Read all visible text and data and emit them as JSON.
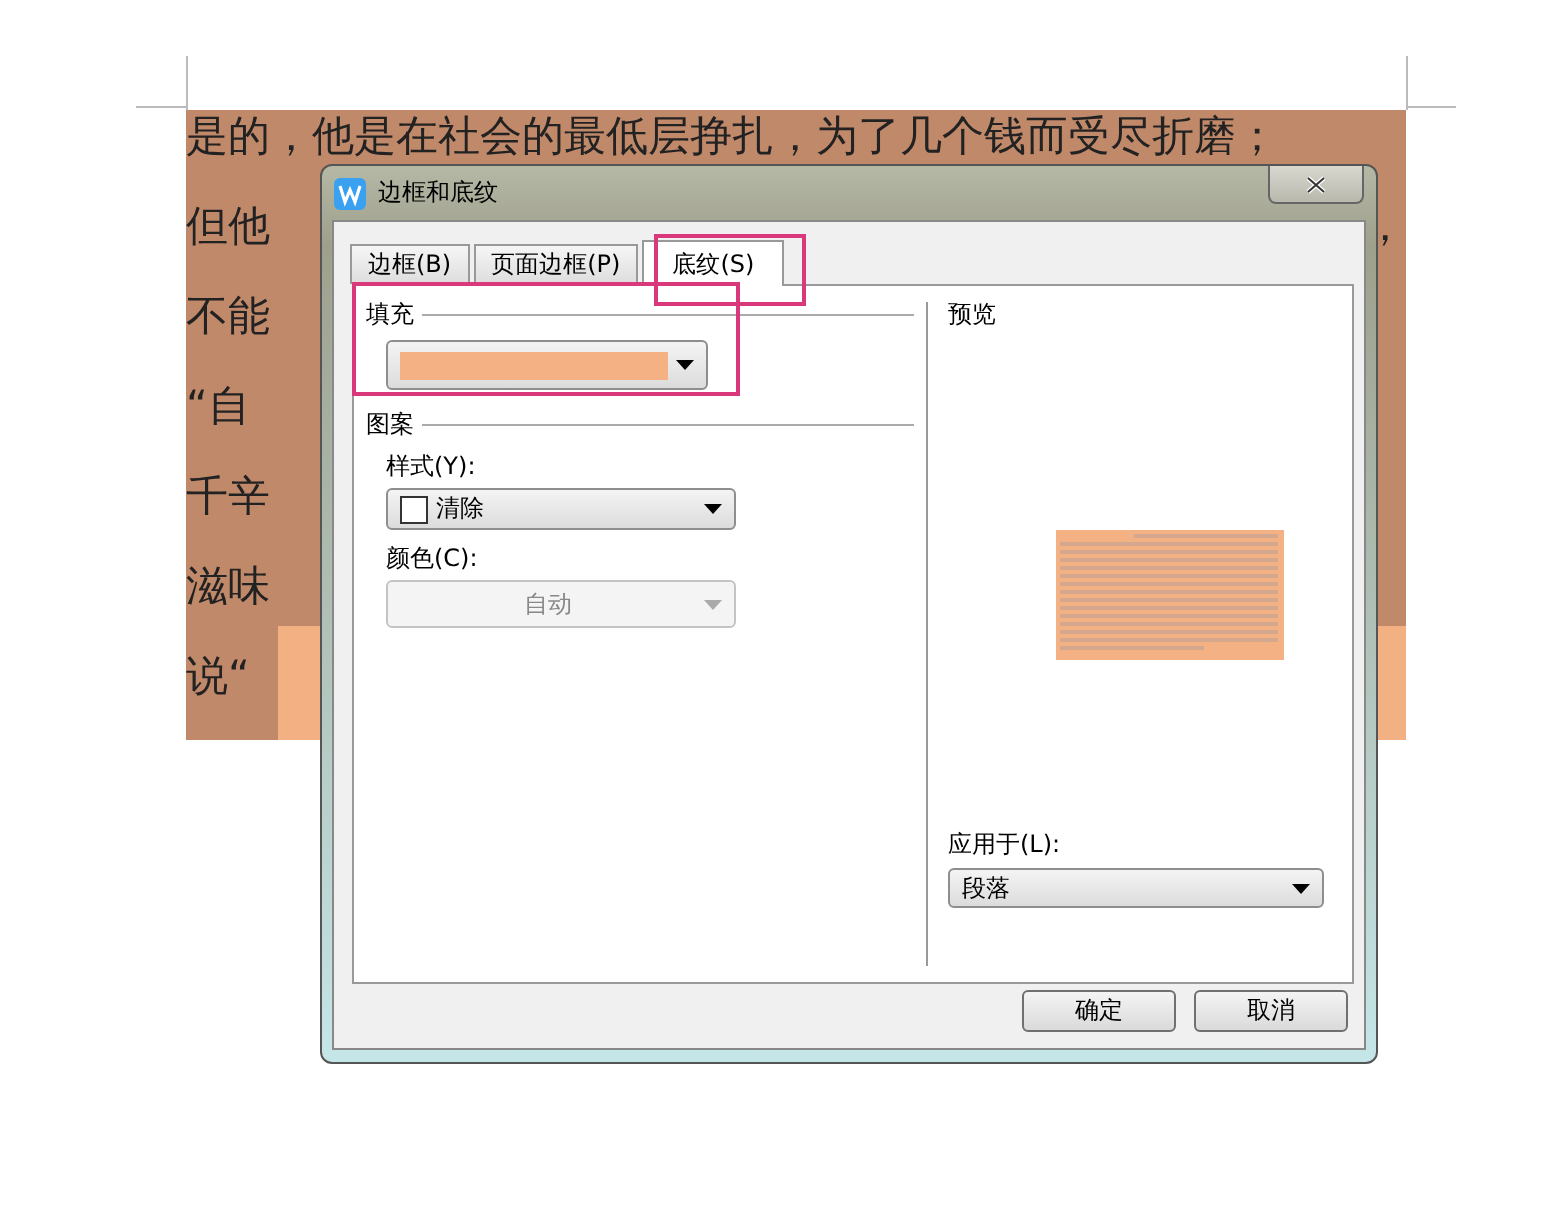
{
  "document": {
    "lines": [
      {
        "left": "是的，他是在社会的最低层挣扎，为了几个钱而受尽折磨；",
        "highlighted": false
      },
      {
        "left": "但他",
        "right": "，",
        "highlighted": false
      },
      {
        "left": "不能",
        "highlighted": false
      },
      {
        "left": "“自",
        "highlighted": false
      },
      {
        "left": "千辛",
        "highlighted": false
      },
      {
        "left": "滋味",
        "highlighted": false
      },
      {
        "left": "说“",
        "highlighted": true
      }
    ]
  },
  "dialog": {
    "title": "边框和底纹",
    "tabs": [
      {
        "label": "边框(B)",
        "selected": false
      },
      {
        "label": "页面边框(P)",
        "selected": false
      },
      {
        "label": "底纹(S)",
        "selected": true
      }
    ],
    "fill": {
      "label": "填充",
      "color": "#f4b183"
    },
    "pattern": {
      "label": "图案",
      "style_label": "样式(Y):",
      "style_value": "清除",
      "color_label": "颜色(C):",
      "color_value": "自动",
      "color_disabled": true
    },
    "preview": {
      "label": "预览"
    },
    "apply_to": {
      "label": "应用于(L):",
      "value": "段落"
    },
    "buttons": [
      "确定",
      "取消"
    ]
  }
}
